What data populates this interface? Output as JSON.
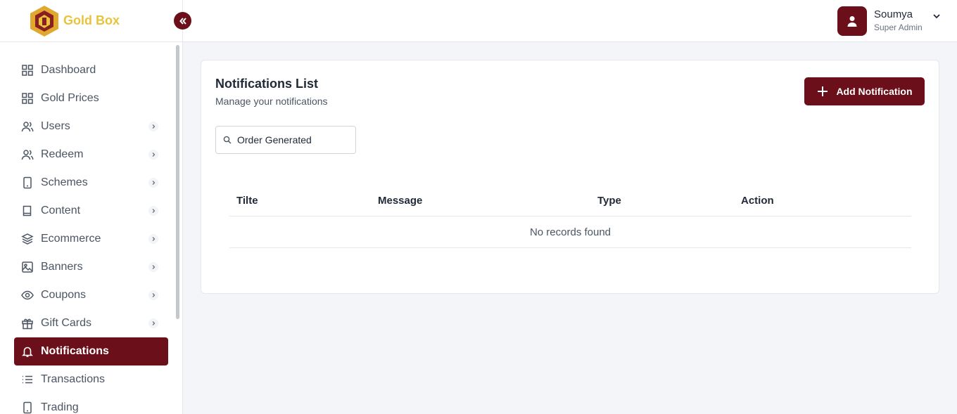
{
  "brand": {
    "name": "Gold Box"
  },
  "user": {
    "name": "Soumya",
    "role": "Super Admin"
  },
  "sidebar": {
    "items": [
      {
        "label": "Dashboard",
        "icon": "grid-icon",
        "has_submenu": false,
        "active": false
      },
      {
        "label": "Gold Prices",
        "icon": "grid-icon",
        "has_submenu": false,
        "active": false
      },
      {
        "label": "Users",
        "icon": "users-icon",
        "has_submenu": true,
        "active": false
      },
      {
        "label": "Redeem",
        "icon": "users-icon",
        "has_submenu": true,
        "active": false
      },
      {
        "label": "Schemes",
        "icon": "tablet-icon",
        "has_submenu": true,
        "active": false
      },
      {
        "label": "Content",
        "icon": "book-icon",
        "has_submenu": true,
        "active": false
      },
      {
        "label": "Ecommerce",
        "icon": "layers-icon",
        "has_submenu": true,
        "active": false
      },
      {
        "label": "Banners",
        "icon": "image-icon",
        "has_submenu": true,
        "active": false
      },
      {
        "label": "Coupons",
        "icon": "eye-icon",
        "has_submenu": true,
        "active": false
      },
      {
        "label": "Gift Cards",
        "icon": "gift-icon",
        "has_submenu": true,
        "active": false
      },
      {
        "label": "Notifications",
        "icon": "bell-icon",
        "has_submenu": false,
        "active": true
      },
      {
        "label": "Transactions",
        "icon": "list-icon",
        "has_submenu": false,
        "active": false
      },
      {
        "label": "Trading",
        "icon": "tablet-icon",
        "has_submenu": false,
        "active": false
      }
    ]
  },
  "main": {
    "title": "Notifications List",
    "subtitle": "Manage your notifications",
    "add_button_label": "Add Notification",
    "search": {
      "value": "Order Generated",
      "placeholder": ""
    },
    "table": {
      "columns": [
        "Tilte",
        "Message",
        "Type",
        "Action"
      ],
      "rows": [],
      "empty_text": "No records found"
    }
  },
  "colors": {
    "primary": "#6b0f1a",
    "brand_gold": "#e8c33c"
  }
}
